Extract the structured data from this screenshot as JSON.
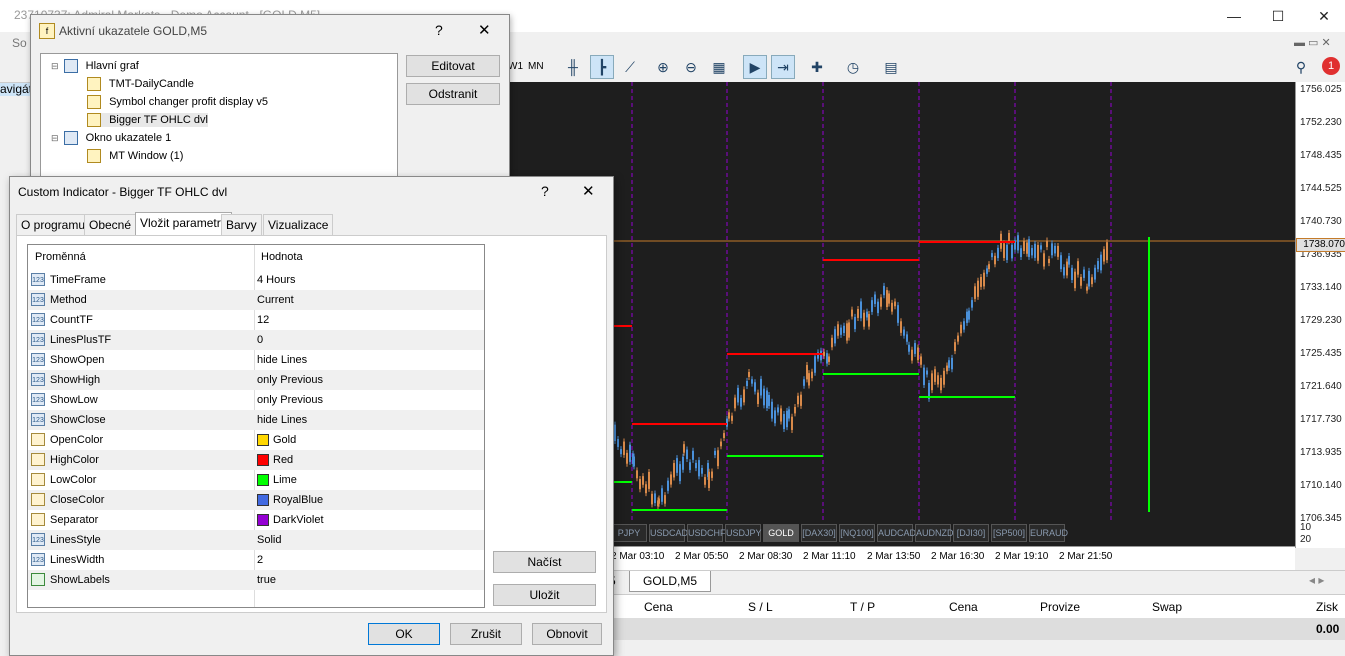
{
  "app": {
    "title": "23710737: Admiral Markets - Demo Account - [GOLD,M5]",
    "sidebar_fragment_1": "So",
    "sidebar_fragment_2": "avigát"
  },
  "toolbar": {
    "period_w1": "W1",
    "period_mn": "MN",
    "notification_badge": "1"
  },
  "active_indicators_dialog": {
    "title": "Aktivní ukazatele GOLD,M5",
    "help": "?",
    "close": "✕",
    "tree": [
      {
        "label": "Hlavní graf",
        "type": "window"
      },
      {
        "label": "TMT-DailyCandle",
        "type": "indicator"
      },
      {
        "label": "Symbol changer profit display v5",
        "type": "indicator"
      },
      {
        "label": "Bigger TF OHLC dvl",
        "type": "indicator"
      },
      {
        "label": "Okno ukazatele 1",
        "type": "window"
      },
      {
        "label": "MT Window (1)",
        "type": "indicator"
      }
    ],
    "edit_button": "Editovat",
    "remove_button": "Odstranit"
  },
  "custom_indicator_dialog": {
    "title": "Custom Indicator - Bigger TF OHLC dvl",
    "help": "?",
    "close": "✕",
    "tabs": [
      "O programu",
      "Obecné",
      "Vložit parametry",
      "Barvy",
      "Vizualizace"
    ],
    "active_tab": "Vložit parametry",
    "col_variable": "Proměnná",
    "col_value": "Hodnota",
    "params": [
      {
        "name": "TimeFrame",
        "value": "4 Hours",
        "icon": "123"
      },
      {
        "name": "Method",
        "value": "Current",
        "icon": "123"
      },
      {
        "name": "CountTF",
        "value": "12",
        "icon": "123"
      },
      {
        "name": "LinesPlusTF",
        "value": "0",
        "icon": "123"
      },
      {
        "name": "ShowOpen",
        "value": "hide Lines",
        "icon": "123"
      },
      {
        "name": "ShowHigh",
        "value": "only Previous",
        "icon": "123"
      },
      {
        "name": "ShowLow",
        "value": "only Previous",
        "icon": "123"
      },
      {
        "name": "ShowClose",
        "value": "hide Lines",
        "icon": "123"
      },
      {
        "name": "OpenColor",
        "value": "Gold",
        "icon": "color",
        "color": "#ffd700"
      },
      {
        "name": "HighColor",
        "value": "Red",
        "icon": "color",
        "color": "#ff0000"
      },
      {
        "name": "LowColor",
        "value": "Lime",
        "icon": "color",
        "color": "#00ff00"
      },
      {
        "name": "CloseColor",
        "value": "RoyalBlue",
        "icon": "color",
        "color": "#4169e1"
      },
      {
        "name": "Separator",
        "value": "DarkViolet",
        "icon": "color",
        "color": "#9400d3"
      },
      {
        "name": "LinesStyle",
        "value": "Solid",
        "icon": "123"
      },
      {
        "name": "LinesWidth",
        "value": "2",
        "icon": "123"
      },
      {
        "name": "ShowLabels",
        "value": "true",
        "icon": "bool"
      }
    ],
    "load_button": "Načíst",
    "save_button": "Uložit",
    "ok_button": "OK",
    "cancel_button": "Zrušit",
    "reset_button": "Obnovit"
  },
  "chart": {
    "price_ticks": [
      "1756.025",
      "1752.230",
      "1748.435",
      "1744.525",
      "1740.730",
      "1736.935",
      "1733.140",
      "1729.230",
      "1725.435",
      "1721.640",
      "1717.730",
      "1713.935",
      "1710.140",
      "1706.345"
    ],
    "current_price": "1738.070",
    "subwindow_ticks": [
      "10",
      "20"
    ],
    "time_ticks": [
      "2 Mar 03:10",
      "2 Mar 05:50",
      "2 Mar 08:30",
      "2 Mar 11:10",
      "2 Mar 13:50",
      "2 Mar 16:30",
      "2 Mar 19:10",
      "2 Mar 21:50"
    ],
    "symbols": [
      "PJPY",
      "USDCAD",
      "USDCHF",
      "USDJPY",
      "GOLD",
      "[DAX30]",
      "[NQ100]",
      "AUDCAD",
      "AUDNZD",
      "[DJI30]",
      "[SP500]",
      "EURAUD"
    ],
    "active_symbol": "GOLD",
    "high_color": "#ff0000",
    "low_color": "#00ff00",
    "separator_color": "#9400d3",
    "up_candle_color": "#4a90d9",
    "down_candle_color": "#d98a4a"
  },
  "chart_tabs": {
    "prev_tab_fragment": "5",
    "active": "GOLD,M5"
  },
  "terminal": {
    "headers": [
      "Cena",
      "S / L",
      "T / P",
      "Cena",
      "Provize",
      "Swap",
      "Zisk"
    ],
    "total": "0.00"
  }
}
